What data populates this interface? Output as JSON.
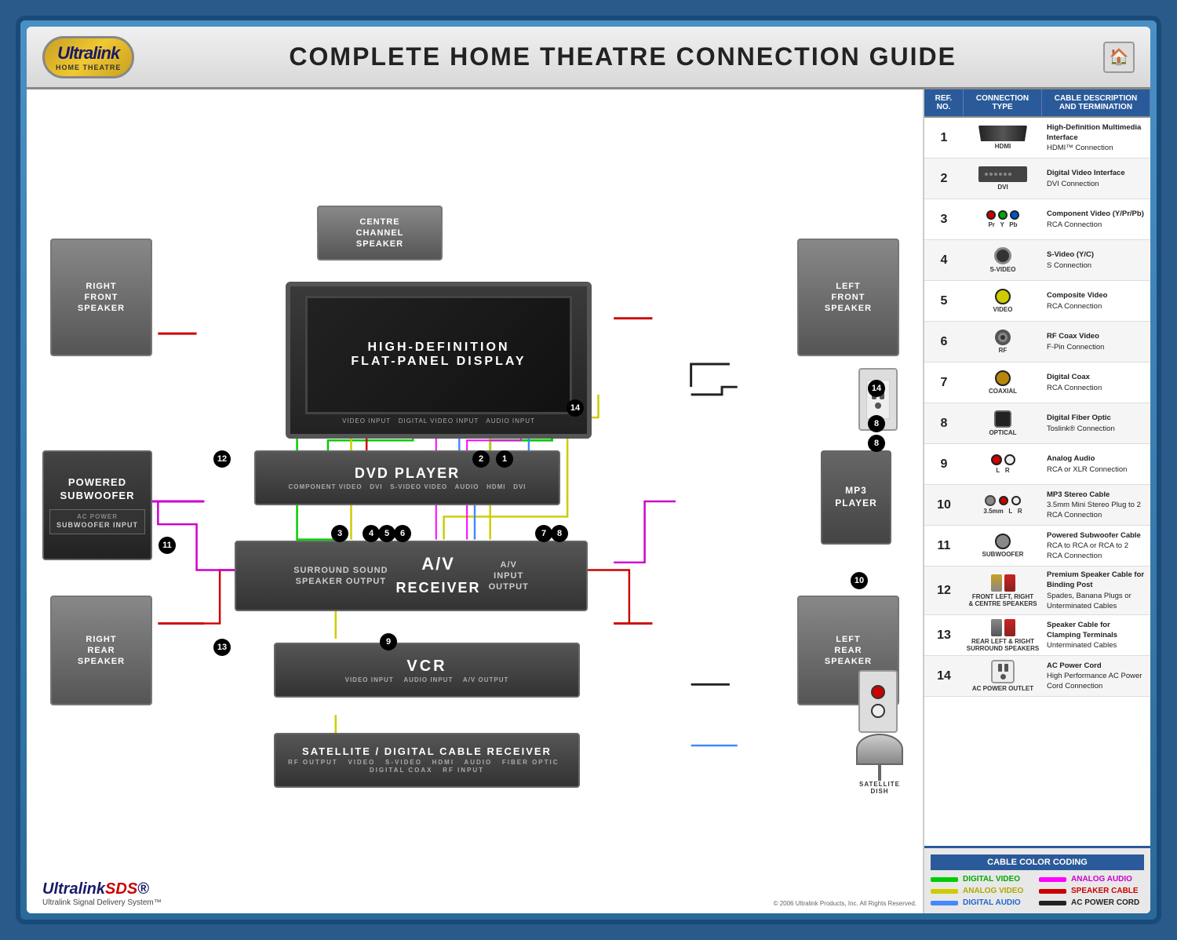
{
  "header": {
    "brand": "Ultralink",
    "brand_sub": "HOME THEATRE",
    "title": "COMPLETE HOME THEATRE CONNECTION GUIDE",
    "home_icon": "🏠"
  },
  "table": {
    "col1": "REF. NO.",
    "col2": "CONNECTION TYPE",
    "col3": "CABLE DESCRIPTION AND TERMINATION",
    "rows": [
      {
        "num": "1",
        "type": "HDMI",
        "title": "High-Definition Multimedia Interface",
        "desc": "HDMI™ Connection"
      },
      {
        "num": "2",
        "type": "DVI",
        "title": "Digital Video Interface",
        "desc": "DVI Connection"
      },
      {
        "num": "3",
        "type": "COMPONENT",
        "title": "Component Video (Y/Pr/Pb)",
        "desc": "RCA Connection"
      },
      {
        "num": "4",
        "type": "S-VIDEO",
        "title": "S-Video (Y/C)",
        "desc": "S Connection"
      },
      {
        "num": "5",
        "type": "VIDEO",
        "title": "Composite Video",
        "desc": "RCA Connection"
      },
      {
        "num": "6",
        "type": "RF",
        "title": "RF Coax Video",
        "desc": "F-Pin Connection"
      },
      {
        "num": "7",
        "type": "COAXIAL",
        "title": "Digital Coax",
        "desc": "RCA Connection"
      },
      {
        "num": "8",
        "type": "OPTICAL",
        "title": "Digital Fiber Optic",
        "desc": "Toslink® Connection"
      },
      {
        "num": "9",
        "type": "ANALOG",
        "title": "Analog Audio",
        "desc": "RCA or XLR Connection"
      },
      {
        "num": "10",
        "type": "3.5mm",
        "title": "MP3 Stereo Cable",
        "desc": "3.5mm Mini Stereo Plug to 2 RCA Connection"
      },
      {
        "num": "11",
        "type": "SUBWOOFER",
        "title": "Powered Subwoofer Cable",
        "desc": "RCA to RCA or RCA to 2 RCA Connection"
      },
      {
        "num": "12",
        "type": "FRONT LEFT, RIGHT & CENTRE SPEAKERS",
        "title": "Premium Speaker Cable for Binding Post",
        "desc": "Spades, Banana Plugs or Unterminated Cables"
      },
      {
        "num": "13",
        "type": "REAR LEFT & RIGHT SURROUND SPEAKERS",
        "title": "Speaker Cable for Clamping Terminals",
        "desc": "Unterminated Cables"
      },
      {
        "num": "14",
        "type": "AC POWER OUTLET",
        "title": "AC Power Cord",
        "desc": "High Performance AC Power Cord Connection"
      }
    ]
  },
  "color_coding": {
    "title": "CABLE COLOR CODING",
    "items": [
      {
        "label": "DIGITAL VIDEO",
        "color": "#00cc00",
        "text_color": "#00aa00"
      },
      {
        "label": "ANALOG AUDIO",
        "color": "#ff00ff",
        "text_color": "#cc00cc"
      },
      {
        "label": "ANALOG VIDEO",
        "color": "#cccc00",
        "text_color": "#aaaa00"
      },
      {
        "label": "SPEAKER CABLE",
        "color": "#cc0000",
        "text_color": "#cc0000"
      },
      {
        "label": "DIGITAL AUDIO",
        "color": "#4488ff",
        "text_color": "#2266cc"
      },
      {
        "label": "AC POWER CORD",
        "color": "#222222",
        "text_color": "#222222"
      }
    ]
  },
  "devices": {
    "tv": "HIGH-DEFINITION\nFLAT-PANEL DISPLAY",
    "dvd": "DVD PLAYER",
    "avr": "A/V\nRECEIVER",
    "vcr": "VCR",
    "satellite": "SATELLITE / DIGITAL CABLE RECEIVER",
    "subwoofer_label": "POWERED\nSUBWOOFER",
    "subwoofer_sub": "SUBWOOFER\nINPUT",
    "mp3": "MP3\nPLAYER",
    "right_front": "RIGHT\nFRONT\nSPEAKER",
    "left_front": "LEFT\nFRONT\nSPEAKER",
    "centre": "CENTRE\nCHANNEL\nSPEAKER",
    "right_rear": "RIGHT\nREAR\nSPEAKER",
    "left_rear": "LEFT\nREAR\nSPEAKER"
  },
  "footer": {
    "brand": "Ultralink",
    "sds": "SDS",
    "trademark": "®",
    "tagline": "Ultralink Signal Delivery System™",
    "copyright": "© 2006 Ultralink Products, Inc. All Rights Reserved."
  },
  "detected_text": {
    "analog_audio_speaker_cable": "ANALOG AUDIO SPEAKER CABLE"
  }
}
